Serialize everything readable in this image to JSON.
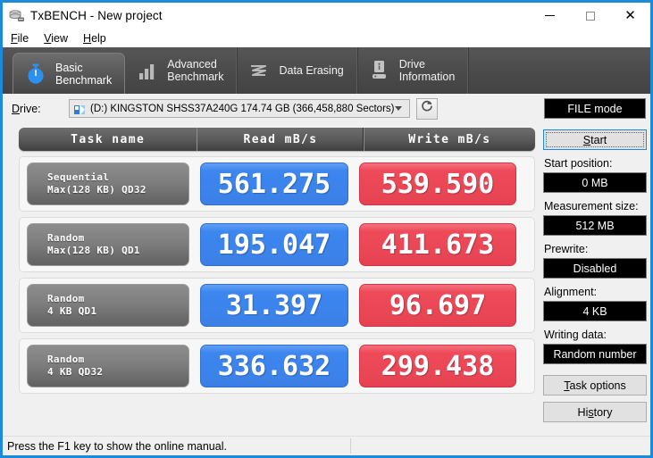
{
  "window": {
    "title": "TxBENCH - New project",
    "app_icon": "drive-icon",
    "controls": {
      "minimize": "minimize-icon",
      "maximize": "maximize-icon",
      "close": "close-icon"
    },
    "accent_color": "#1c8ad9"
  },
  "menu": [
    {
      "label": "File",
      "accel": "F"
    },
    {
      "label": "View",
      "accel": "V"
    },
    {
      "label": "Help",
      "accel": "H"
    }
  ],
  "tabs": [
    {
      "label_line1": "Basic",
      "label_line2": "Benchmark",
      "icon": "stopwatch-icon",
      "active": true
    },
    {
      "label_line1": "Advanced",
      "label_line2": "Benchmark",
      "icon": "bar-chart-icon",
      "active": false
    },
    {
      "label_line1": "Data Erasing",
      "label_line2": "",
      "icon": "eraser-waves-icon",
      "active": false
    },
    {
      "label_line1": "Drive",
      "label_line2": "Information",
      "icon": "drive-info-icon",
      "active": false
    }
  ],
  "drive": {
    "label": "Drive:",
    "label_accel": "D",
    "icon": "disk-drive-icon",
    "selected": "(D:) KINGSTON SHSS37A240G  174.74 GB (366,458,880 Sectors)",
    "refresh_icon": "refresh-icon",
    "mode_button": "FILE mode"
  },
  "results": {
    "headers": [
      "Task name",
      "Read mB/s",
      "Write mB/s"
    ],
    "rows": [
      {
        "task_line1": "Sequential",
        "task_line2": "Max(128 KB) QD32",
        "read": "561.275",
        "write": "539.590"
      },
      {
        "task_line1": "Random",
        "task_line2": "Max(128 KB) QD1",
        "read": "195.047",
        "write": "411.673"
      },
      {
        "task_line1": "Random",
        "task_line2": "4 KB QD1",
        "read": "31.397",
        "write": "96.697"
      },
      {
        "task_line1": "Random",
        "task_line2": "4 KB QD32",
        "read": "336.632",
        "write": "299.438"
      }
    ],
    "read_color": "#3d86ef",
    "write_color": "#ee4a59"
  },
  "chart_data": {
    "type": "bar",
    "title": "TxBENCH Basic Benchmark results",
    "categories": [
      "Sequential Max(128 KB) QD32",
      "Random Max(128 KB) QD1",
      "Random 4 KB QD1",
      "Random 4 KB QD32"
    ],
    "series": [
      {
        "name": "Read mB/s",
        "values": [
          561.275,
          195.047,
          31.397,
          336.632
        ]
      },
      {
        "name": "Write mB/s",
        "values": [
          539.59,
          411.673,
          96.697,
          299.438
        ]
      }
    ],
    "xlabel": "Task name",
    "ylabel": "mB/s",
    "legend": "top",
    "grid": false
  },
  "panel": {
    "start_button": {
      "prefix": "",
      "accel": "S",
      "suffix": "tart"
    },
    "fields": [
      {
        "label": "Start position:",
        "value": "0 MB"
      },
      {
        "label": "Measurement size:",
        "value": "512 MB"
      },
      {
        "label": "Prewrite:",
        "value": "Disabled"
      },
      {
        "label": "Alignment:",
        "value": "4 KB"
      },
      {
        "label": "Writing data:",
        "value": "Random number"
      }
    ],
    "task_options_button": {
      "accel": "T",
      "suffix": "ask options"
    },
    "history_button": {
      "prefix": "Hi",
      "accel": "s",
      "suffix": "tory"
    }
  },
  "statusbar": {
    "text": "Press the F1 key to show the online manual."
  }
}
